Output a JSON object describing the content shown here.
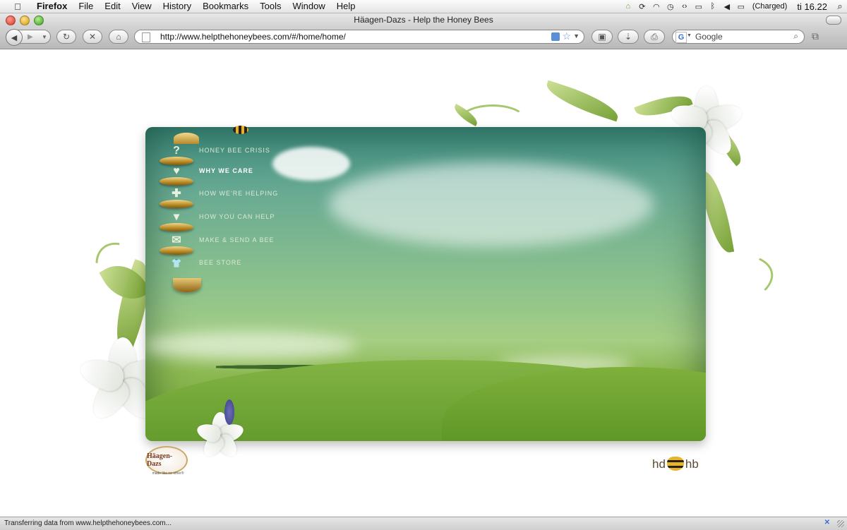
{
  "menubar": {
    "apple": "",
    "app": "Firefox",
    "items": [
      "File",
      "Edit",
      "View",
      "History",
      "Bookmarks",
      "Tools",
      "Window",
      "Help"
    ],
    "battery_status": "(Charged)",
    "clock": "ti 16.22"
  },
  "window": {
    "title": "Häagen-Dazs - Help the Honey Bees"
  },
  "toolbar": {
    "url": "http://www.helpthehoneybees.com/#/home/home/",
    "search_placeholder": "Google",
    "search_engine_glyph": "G"
  },
  "site": {
    "nav": [
      {
        "label": "HONEY BEE CRISIS",
        "icon": "?",
        "active": false
      },
      {
        "label": "WHY WE CARE",
        "icon": "♥",
        "active": true
      },
      {
        "label": "HOW WE'RE HELPING",
        "icon": "✚",
        "active": false
      },
      {
        "label": "HOW YOU CAN HELP",
        "icon": "▾",
        "active": false
      },
      {
        "label": "MAKE & SEND A BEE",
        "icon": "✉",
        "active": false
      },
      {
        "label": "BEE STORE",
        "icon": "👕",
        "active": false
      }
    ],
    "brand_logo": "Häagen-Dazs",
    "brand_tagline": "made like no other®",
    "hdhb_left": "hd",
    "hdhb_right": "hb"
  },
  "statusbar": {
    "text": "Transferring data from www.helpthehoneybees.com..."
  },
  "colors": {
    "accent_gold": "#c9a441",
    "sky": "#6aab93",
    "grass": "#6c9f2f"
  }
}
